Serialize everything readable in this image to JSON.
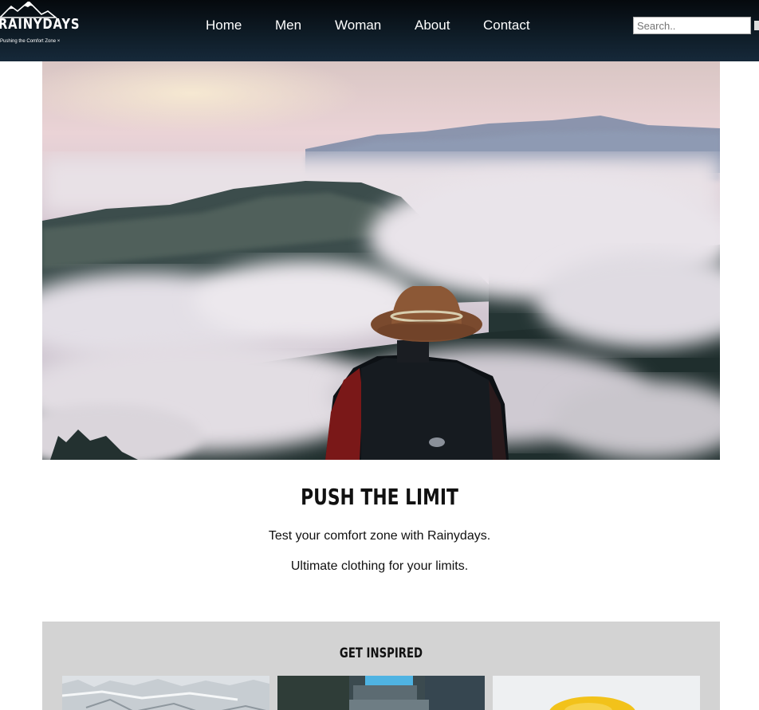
{
  "header": {
    "logo": {
      "name": "RAINYDAYS",
      "tagline": "Pushing the Comfort Zone ×"
    },
    "nav": [
      {
        "label": "Home"
      },
      {
        "label": "Men"
      },
      {
        "label": "Woman"
      },
      {
        "label": "About"
      },
      {
        "label": "Contact"
      }
    ],
    "search": {
      "placeholder": "Search.."
    }
  },
  "hero": {
    "image": "hiker-in-hat-above-clouds"
  },
  "tagline": {
    "title": "PUSH THE LIMIT",
    "line1": "Test your comfort zone with Rainydays.",
    "line2": "Ultimate clothing for your limits."
  },
  "inspired": {
    "title": "GET INSPIRED",
    "images": [
      "frosty-ground",
      "blue-water-scene",
      "yellow-hood"
    ]
  },
  "colors": {
    "header_dark": "#0b141c",
    "section_gray": "#d3d3d3",
    "text": "#111111"
  }
}
